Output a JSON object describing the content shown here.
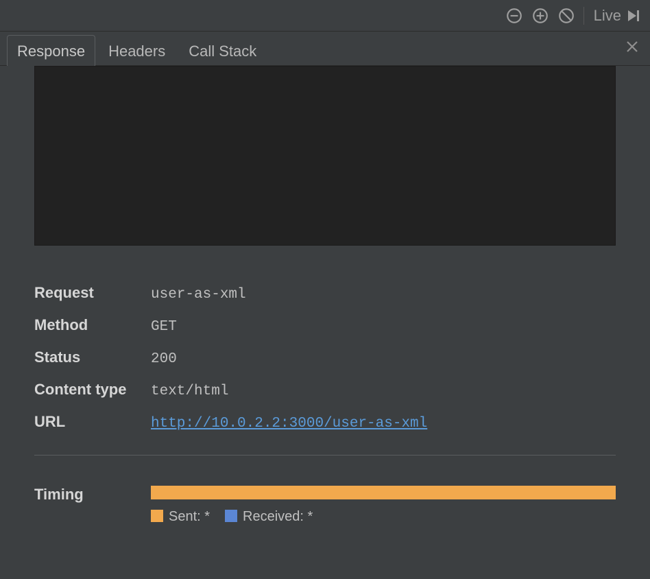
{
  "toolbar": {
    "live_label": "Live"
  },
  "tabs": {
    "response": "Response",
    "headers": "Headers",
    "callstack": "Call Stack"
  },
  "details": {
    "request_label": "Request",
    "request_value": "user-as-xml",
    "method_label": "Method",
    "method_value": "GET",
    "status_label": "Status",
    "status_value": "200",
    "content_type_label": "Content type",
    "content_type_value": "text/html",
    "url_label": "URL",
    "url_value": "http://10.0.2.2:3000/user-as-xml"
  },
  "timing": {
    "label": "Timing",
    "sent_label": "Sent: *",
    "received_label": "Received: *",
    "sent_color": "#f2a94d",
    "received_color": "#5b86d4"
  }
}
